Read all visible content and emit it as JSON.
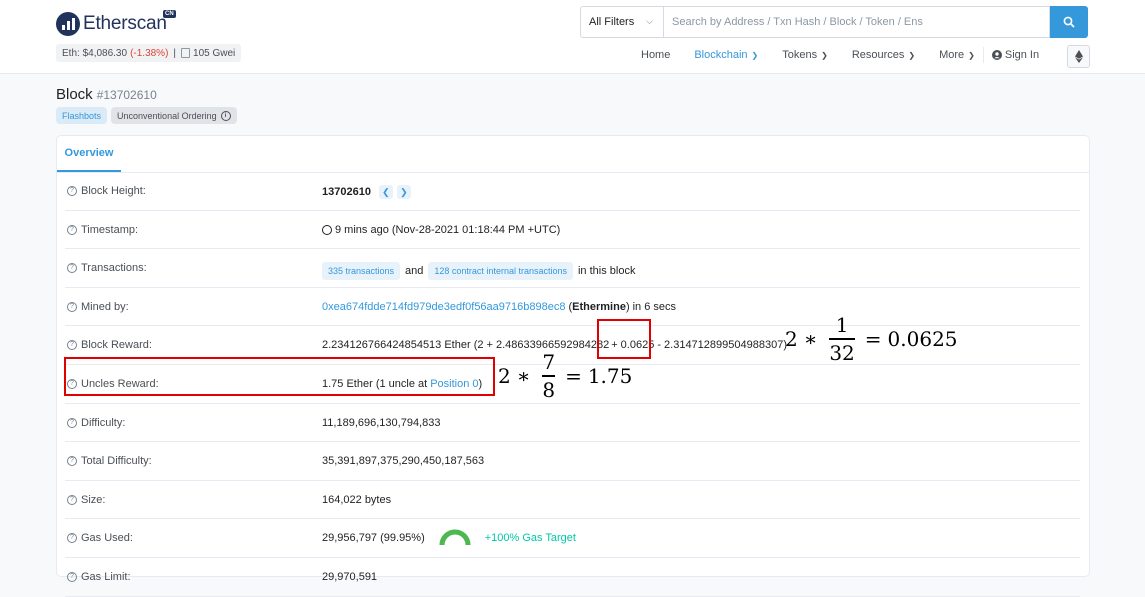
{
  "header": {
    "logo_text": "Etherscan",
    "logo_badge": "CN",
    "eth_price_label": "Eth: $4,086.30",
    "eth_change": "(-1.38%)",
    "gas": "105 Gwei",
    "search": {
      "filter": "All Filters",
      "placeholder": "Search by Address / Txn Hash / Block / Token / Ens"
    },
    "nav": [
      {
        "label": "Home"
      },
      {
        "label": "Blockchain"
      },
      {
        "label": "Tokens"
      },
      {
        "label": "Resources"
      },
      {
        "label": "More"
      },
      {
        "label": "Sign In"
      }
    ]
  },
  "page": {
    "title": "Block",
    "block_number": "#13702610",
    "badges": [
      "Flashbots",
      "Unconventional Ordering"
    ],
    "tab": "Overview"
  },
  "rows": {
    "block_height": {
      "label": "Block Height:",
      "value": "13702610"
    },
    "timestamp": {
      "label": "Timestamp:",
      "value": "9 mins ago (Nov-28-2021 01:18:44 PM +UTC)"
    },
    "transactions": {
      "label": "Transactions:",
      "txns": "335 transactions",
      "and": "and",
      "internal": "128 contract internal transactions",
      "suffix": "in this block"
    },
    "mined_by": {
      "label": "Mined by:",
      "address": "0xea674fdde714fd979de3edf0f56aa9716b898ec8",
      "name": "Ethermine",
      "suffix": "in 6 secs"
    },
    "block_reward": {
      "label": "Block Reward:",
      "total": "2.234126766424854513 Ether (2 + 2.48633966592984282",
      "plus": "+ 0.0625",
      "rest": "- 2.314712899504988307)"
    },
    "uncles_reward": {
      "label": "Uncles Reward:",
      "prefix": "1.75 Ether (1 uncle at",
      "position": "Position 0",
      "suffix": ")"
    },
    "difficulty": {
      "label": "Difficulty:",
      "value": "11,189,696,130,794,833"
    },
    "total_difficulty": {
      "label": "Total Difficulty:",
      "value": "35,391,897,375,290,450,187,563"
    },
    "size": {
      "label": "Size:",
      "value": "164,022 bytes"
    },
    "gas_used": {
      "label": "Gas Used:",
      "value": "29,956,797 (99.95%)",
      "target": "+100% Gas Target",
      "gauge_fraction": 0.9995
    },
    "gas_limit": {
      "label": "Gas Limit:",
      "value": "29,970,591"
    }
  },
  "annotations": {
    "eq1": {
      "coef": "2",
      "op": "∗",
      "num": "1",
      "den": "32",
      "eq": "=",
      "result": "0.0625"
    },
    "eq2": {
      "coef": "2",
      "op": "∗",
      "num": "7",
      "den": "8",
      "eq": "=",
      "result": "1.75"
    }
  },
  "colors": {
    "accent": "#3498db",
    "brand": "#21325b",
    "annotation": "#e00000",
    "positive": "#00c9a7"
  }
}
